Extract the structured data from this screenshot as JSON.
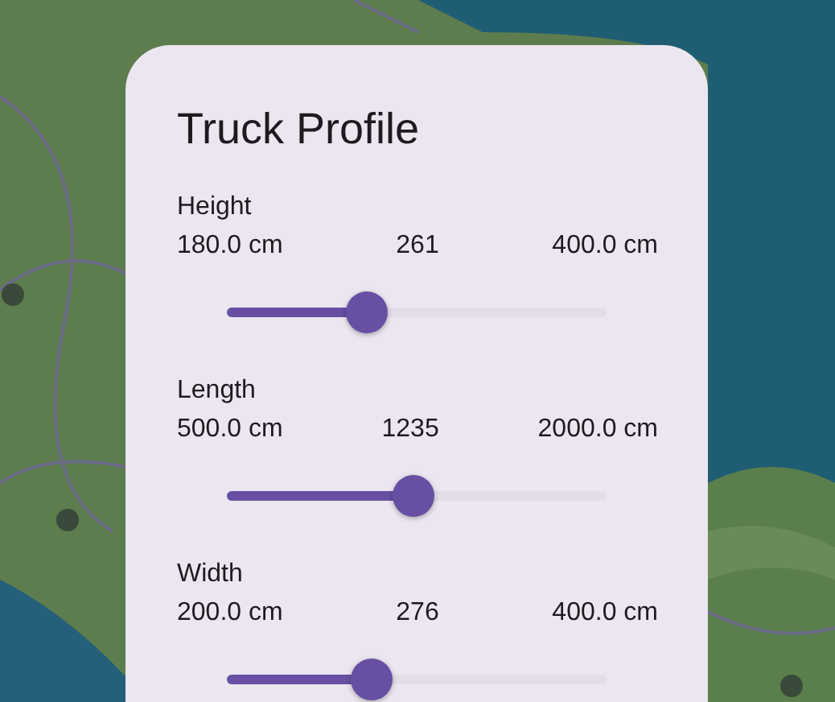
{
  "title": "Truck Profile",
  "sliders": [
    {
      "label": "Height",
      "min": "180.0 cm",
      "value": "261",
      "max": "400.0 cm",
      "level": 0.368
    },
    {
      "label": "Length",
      "min": "500.0 cm",
      "value": "1235",
      "max": "2000.0 cm",
      "level": 0.49
    },
    {
      "label": "Width",
      "min": "200.0 cm",
      "value": "276",
      "max": "400.0 cm",
      "level": 0.38
    }
  ]
}
